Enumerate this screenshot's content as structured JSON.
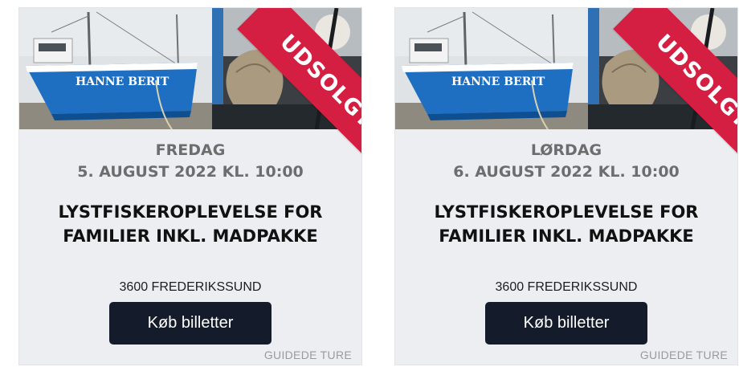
{
  "cards": [
    {
      "ribbon": "UDSOLGT",
      "day": "FREDAG",
      "date": "5. AUGUST 2022 KL. 10:00",
      "title": "LYSTFISKEROPLEVELSE FOR FAMILIER INKL. MADPAKKE",
      "location": "3600 FREDERIKSSUND",
      "button": "Køb billetter",
      "category": "GUIDEDE TURE",
      "boat_name": "HANNE BERIT"
    },
    {
      "ribbon": "UDSOLGT",
      "day": "LØRDAG",
      "date": "6. AUGUST 2022 KL. 10:00",
      "title": "LYSTFISKEROPLEVELSE FOR FAMILIER INKL. MADPAKKE",
      "location": "3600 FREDERIKSSUND",
      "button": "Køb billetter",
      "category": "GUIDEDE TURE",
      "boat_name": "HANNE BERIT"
    }
  ],
  "colors": {
    "ribbon": "#d41e42",
    "button": "#141c2b",
    "card_bg": "#eceef1",
    "boat_hull": "#1e6fc2"
  }
}
